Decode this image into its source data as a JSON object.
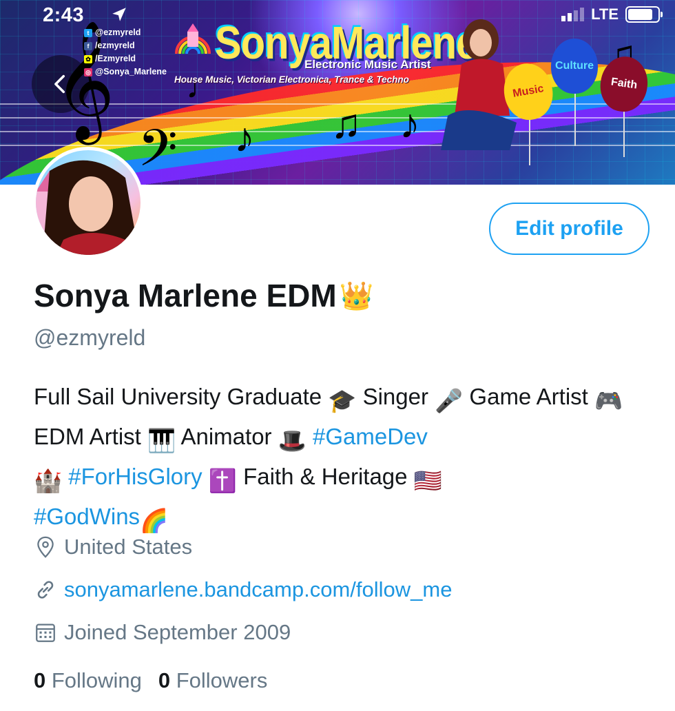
{
  "status_bar": {
    "time": "2:43",
    "network": "LTE",
    "battery_level": 0.85
  },
  "banner": {
    "socials": [
      {
        "icon": "twitter-icon",
        "color": "#1da1f2",
        "label": "@ezmyreld"
      },
      {
        "icon": "facebook-icon",
        "color": "#3b5998",
        "label": "/ezmyreld"
      },
      {
        "icon": "snapchat-icon",
        "color": "#fffc00",
        "label": "/Ezmyreld"
      },
      {
        "icon": "instagram-icon",
        "color": "#e1306c",
        "label": "@Sonya_Marlene"
      }
    ],
    "brand": "SonyaMarlene",
    "subtitle": "Electronic Music Artist",
    "genres": "House Music, Victorian Electronica, Trance & Techno",
    "balloons": [
      {
        "label": "Music",
        "color": "#ffd11a",
        "text_color": "#c81e1e"
      },
      {
        "label": "Culture",
        "color": "#1e4fd6",
        "text_color": "#5fe0ff"
      },
      {
        "label": "Faith",
        "color": "#8a0d2a",
        "text_color": "#ffffff"
      }
    ]
  },
  "profile": {
    "edit_button": "Edit profile",
    "name": "Sonya Marlene EDM",
    "name_emoji": "👑",
    "handle": "@ezmyreld",
    "bio": {
      "l1a": "Full Sail University Graduate",
      "e1": "🎓",
      "l1b": "Singer",
      "e2": "🎤",
      "l1c": "Game",
      "l2a": "Artist",
      "e3": "🎮",
      "l2b": "EDM Artist",
      "e4": "🎹",
      "l2c": "Animator",
      "e5": "🎩",
      "tag1": "#GameDev",
      "e6": "🏰",
      "tag2": "#ForHisGlory",
      "e7": "✝️",
      "l3a": "Faith & Heritage",
      "e8": "🇺🇸",
      "tag3": "#GodWins",
      "e9": "🌈"
    },
    "location": "United States",
    "website": "sonyamarlene.bandcamp.com/follow_me",
    "joined": "Joined September 2009",
    "following_count": "0",
    "following_label": "Following",
    "followers_count": "0",
    "followers_label": "Followers"
  },
  "colors": {
    "accent": "#1da1f2",
    "link": "#1b95e0",
    "muted": "#657786",
    "text": "#14171a"
  }
}
